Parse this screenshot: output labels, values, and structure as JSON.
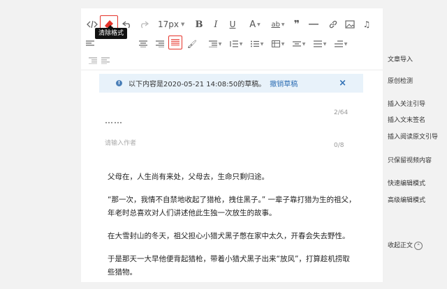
{
  "toolbar": {
    "font_size": "17px",
    "tooltip": "清除格式"
  },
  "draft": {
    "message": "以下内容是2020-05-21 14:08:50的草稿。",
    "undo_label": "撤销草稿",
    "close_label": "×"
  },
  "article": {
    "title": "……",
    "title_count": "2/64",
    "author_placeholder": "请输入作者",
    "author_count": "0/8",
    "paragraphs": [
      "父母在，人生尚有来处，父母去，生命只剩归途。",
      "“那一次，我情不自禁地收起了猎枪，拽住黑子。” 一辈子靠打猎为生的祖父，年老时总喜欢对人们讲述他此生独一次放生的故事。",
      "在大雪封山的冬天，祖父担心小猎犬黑子憋在家中太久，开春会失去野性。",
      "于是那天一大早他便背起猎枪，带着小猎犬黑子出来“放风”，打算趁机捞取些猎物。"
    ]
  },
  "sidebar": {
    "items": [
      "文章导入",
      "原创检测",
      "插入关注引导",
      "插入文末签名",
      "插入阅读原文引导",
      "只保留视频内容",
      "快速编辑模式",
      "高级编辑模式"
    ],
    "collapse_label": "收起正文",
    "collapse_icon": "⌃"
  }
}
